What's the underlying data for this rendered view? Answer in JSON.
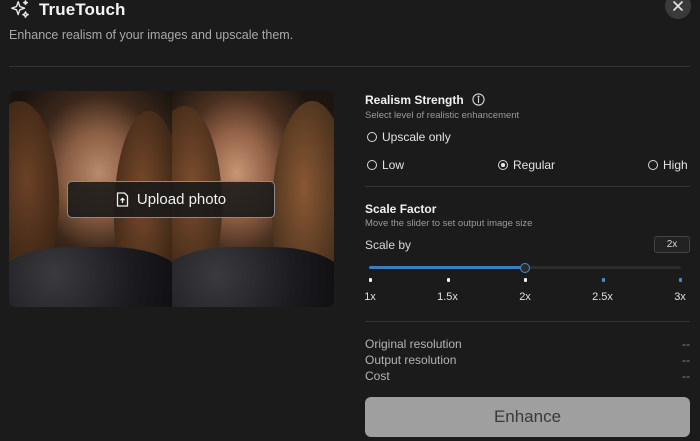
{
  "app": {
    "title": "TrueTouch",
    "subtitle": "Enhance realism of your images and upscale them."
  },
  "preview": {
    "upload_label": "Upload photo"
  },
  "realism": {
    "title": "Realism Strength",
    "description": "Select level of realistic enhancement",
    "options": [
      {
        "label": "Upscale only",
        "selected": false
      },
      {
        "label": "Low",
        "selected": false
      },
      {
        "label": "Regular",
        "selected": true
      },
      {
        "label": "High",
        "selected": false
      }
    ]
  },
  "scale": {
    "title": "Scale Factor",
    "description": "Move the slider to set output image size",
    "label": "Scale by",
    "value": "2x",
    "value_fraction": 0.5,
    "ticks": [
      "1x",
      "1.5x",
      "2x",
      "2.5x",
      "3x"
    ]
  },
  "info": {
    "rows": [
      {
        "label": "Original resolution",
        "value": "--"
      },
      {
        "label": "Output resolution",
        "value": "--"
      },
      {
        "label": "Cost",
        "value": "--"
      }
    ]
  },
  "actions": {
    "enhance_label": "Enhance"
  },
  "colors": {
    "background": "#1b1b1b",
    "accent": "#3a7fc4",
    "button_disabled": "#9f9f9f"
  },
  "icons": {
    "title": "sparkle-icon",
    "close": "close-icon",
    "upload": "file-upload-icon",
    "info": "info-icon"
  }
}
